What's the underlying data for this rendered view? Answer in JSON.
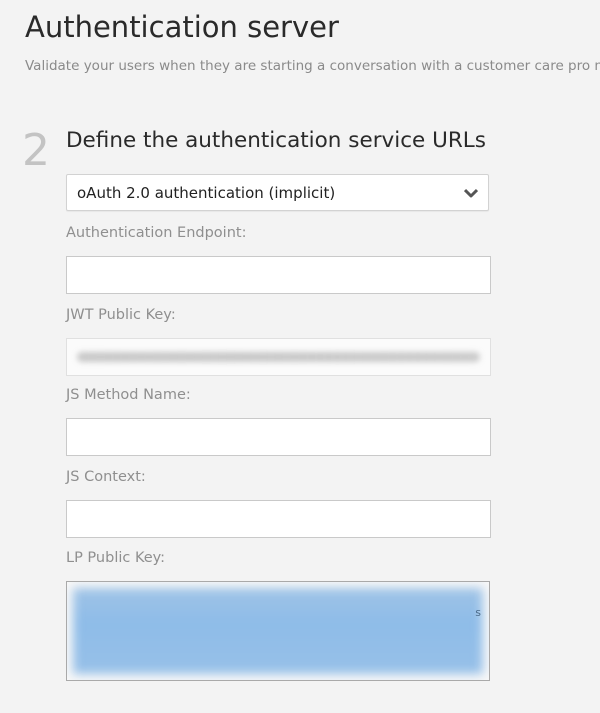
{
  "header": {
    "title": "Authentication server",
    "description": "Validate your users when they are starting a conversation with a customer care pro meaningful connection."
  },
  "step": {
    "number": "2",
    "title": "Define the authentication service URLs"
  },
  "auth_type": {
    "selected": "oAuth 2.0 authentication (implicit)"
  },
  "fields": {
    "auth_endpoint": {
      "label": "Authentication Endpoint:",
      "value": ""
    },
    "jwt_public_key": {
      "label": "JWT Public Key:"
    },
    "js_method_name": {
      "label": "JS Method Name:",
      "value": ""
    },
    "js_context": {
      "label": "JS Context:",
      "value": ""
    },
    "lp_public_key": {
      "label": "LP Public Key:",
      "visible_char": "s"
    }
  },
  "colors": {
    "background": "#f3f3f3",
    "label": "#8f8f8f",
    "selection_highlight": "#8ebce8"
  }
}
